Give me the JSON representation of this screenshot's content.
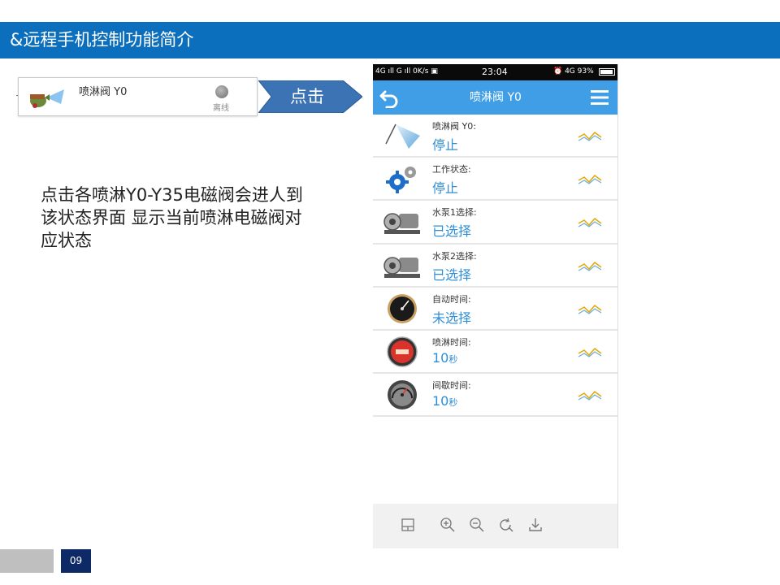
{
  "slide": {
    "title": "&远程手机控制功能简介",
    "description": "点击各喷淋Y0-Y35电磁阀会进人到该状态界面 显示当前喷淋电磁阀对应状态",
    "page_number": "09"
  },
  "device_card": {
    "name": "喷淋阀 Y0",
    "status": "离线",
    "icon": "sprinkler-valve-icon"
  },
  "arrow_label": "点击",
  "phone": {
    "status_bar": {
      "left": "4G ıll G ıll 0K/s ▣",
      "time": "23:04",
      "right": "⏰ 4G 93%",
      "battery_percent": 93
    },
    "nav": {
      "title": "喷淋阀 Y0",
      "back_icon": "back-arrow-icon",
      "menu_icon": "hamburger-menu-icon"
    },
    "rows": [
      {
        "label": "喷淋阀 Y0:",
        "value": "停止",
        "unit": "",
        "icon": "sprinkler-icon"
      },
      {
        "label": "工作状态:",
        "value": "停止",
        "unit": "",
        "icon": "gears-icon"
      },
      {
        "label": "水泵1选择:",
        "value": "已选择",
        "unit": "",
        "icon": "water-pump-icon"
      },
      {
        "label": "水泵2选择:",
        "value": "已选择",
        "unit": "",
        "icon": "water-pump-icon"
      },
      {
        "label": "自动时间:",
        "value": "未选择",
        "unit": "",
        "icon": "dial-gauge-icon"
      },
      {
        "label": "喷淋时间:",
        "value": "10",
        "unit": "秒",
        "icon": "red-gauge-icon"
      },
      {
        "label": "间歇时间:",
        "value": "10",
        "unit": "秒",
        "icon": "speedometer-icon"
      }
    ],
    "toolbar": [
      {
        "icon": "layout-icon"
      },
      {
        "icon": "zoom-in-icon"
      },
      {
        "icon": "zoom-out-icon"
      },
      {
        "icon": "refresh-icon"
      },
      {
        "icon": "download-icon"
      }
    ]
  },
  "colors": {
    "title_bar": "#0b6fbd",
    "nav_bar": "#3f9ee6",
    "value_text": "#2e8fd8",
    "arrow": "#3b73b5",
    "page_badge": "#0e2a66"
  }
}
